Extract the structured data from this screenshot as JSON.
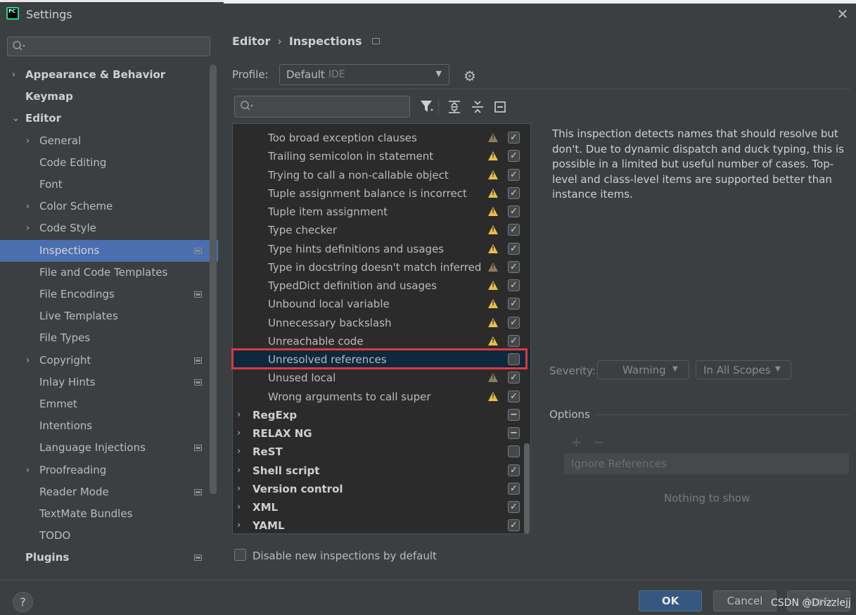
{
  "window": {
    "title": "Settings"
  },
  "sidebar": {
    "search_placeholder": "",
    "items": [
      {
        "label": "Appearance & Behavior",
        "bold": true,
        "chevron": "›",
        "level": 0
      },
      {
        "label": "Keymap",
        "bold": true,
        "chevron": "",
        "level": 0
      },
      {
        "label": "Editor",
        "bold": true,
        "chevron": "⌄",
        "level": 0
      },
      {
        "label": "General",
        "chevron": "›",
        "level": 1
      },
      {
        "label": "Code Editing",
        "chevron": "",
        "level": 1
      },
      {
        "label": "Font",
        "chevron": "",
        "level": 1
      },
      {
        "label": "Color Scheme",
        "chevron": "›",
        "level": 1
      },
      {
        "label": "Code Style",
        "chevron": "›",
        "level": 1
      },
      {
        "label": "Inspections",
        "chevron": "",
        "level": 1,
        "selected": true,
        "project_icon": true
      },
      {
        "label": "File and Code Templates",
        "chevron": "",
        "level": 1
      },
      {
        "label": "File Encodings",
        "chevron": "",
        "level": 1,
        "project_icon": true
      },
      {
        "label": "Live Templates",
        "chevron": "",
        "level": 1
      },
      {
        "label": "File Types",
        "chevron": "",
        "level": 1
      },
      {
        "label": "Copyright",
        "chevron": "›",
        "level": 1,
        "project_icon": true
      },
      {
        "label": "Inlay Hints",
        "chevron": "",
        "level": 1,
        "project_icon": true
      },
      {
        "label": "Emmet",
        "chevron": "",
        "level": 1
      },
      {
        "label": "Intentions",
        "chevron": "",
        "level": 1
      },
      {
        "label": "Language Injections",
        "chevron": "",
        "level": 1,
        "project_icon": true
      },
      {
        "label": "Proofreading",
        "chevron": "›",
        "level": 1
      },
      {
        "label": "Reader Mode",
        "chevron": "",
        "level": 1,
        "project_icon": true
      },
      {
        "label": "TextMate Bundles",
        "chevron": "",
        "level": 1
      },
      {
        "label": "TODO",
        "chevron": "",
        "level": 1
      },
      {
        "label": "Plugins",
        "bold": true,
        "chevron": "",
        "level": 0,
        "project_icon": true
      }
    ]
  },
  "breadcrumb": {
    "parent": "Editor",
    "current": "Inspections"
  },
  "profile": {
    "label": "Profile:",
    "value": "Default",
    "tag": "IDE"
  },
  "inspections": {
    "search_placeholder": "",
    "rows": [
      {
        "label": "Too broad exception clauses",
        "warn": "dim",
        "checked": true
      },
      {
        "label": "Trailing semicolon in statement",
        "warn": "yes",
        "checked": true
      },
      {
        "label": "Trying to call a non-callable object",
        "warn": "yes",
        "checked": true
      },
      {
        "label": "Tuple assignment balance is incorrect",
        "warn": "yes",
        "checked": true
      },
      {
        "label": "Tuple item assignment",
        "warn": "yes",
        "checked": true
      },
      {
        "label": "Type checker",
        "warn": "yes",
        "checked": true
      },
      {
        "label": "Type hints definitions and usages",
        "warn": "yes",
        "checked": true
      },
      {
        "label": "Type in docstring doesn't match inferred t",
        "warn": "dim",
        "checked": true
      },
      {
        "label": "TypedDict definition and usages",
        "warn": "yes",
        "checked": true
      },
      {
        "label": "Unbound local variable",
        "warn": "yes",
        "checked": true
      },
      {
        "label": "Unnecessary backslash",
        "warn": "yes",
        "checked": true
      },
      {
        "label": "Unreachable code",
        "warn": "yes",
        "checked": true
      },
      {
        "label": "Unresolved references",
        "warn": "none",
        "checked": false,
        "highlight": true
      },
      {
        "label": "Unused local",
        "warn": "dim",
        "checked": true
      },
      {
        "label": "Wrong arguments to call super",
        "warn": "yes",
        "checked": true
      }
    ],
    "groups": [
      {
        "label": "RegExp",
        "state": "partial"
      },
      {
        "label": "RELAX NG",
        "state": "partial"
      },
      {
        "label": "ReST",
        "state": "unchecked"
      },
      {
        "label": "Shell script",
        "state": "checked"
      },
      {
        "label": "Version control",
        "state": "checked"
      },
      {
        "label": "XML",
        "state": "checked"
      },
      {
        "label": "YAML",
        "state": "checked"
      }
    ]
  },
  "description": "This inspection detects names that should resolve but don't. Due to dynamic dispatch and duck typing, this is possible in a limited but useful number of cases. Top-level and class-level items are supported better than instance items.",
  "severity": {
    "label": "Severity:",
    "value": "Warning",
    "scope": "In All Scopes"
  },
  "options": {
    "label": "Options",
    "add": "+",
    "remove": "−",
    "list_header": "Ignore References",
    "empty_text": "Nothing to show"
  },
  "disable_new": {
    "label": "Disable new inspections by default",
    "checked": false
  },
  "footer": {
    "help": "?",
    "ok": "OK",
    "cancel": "Cancel",
    "apply": "Apply",
    "watermark": "CSDN @Drizzlejj"
  },
  "colors": {
    "background": "#3c3f41",
    "list_bg": "#2b2b2b",
    "selection": "#4b6eaf",
    "row_highlight": "#0d293e",
    "red_outline": "#e0373f",
    "warning": "#e8c04a",
    "ok_button": "#365880"
  },
  "icons": {
    "app": "pycharm-logo",
    "close": "close-icon",
    "gear": "gear-icon",
    "filter": "filter-icon",
    "expand": "expand-all-icon",
    "collapse": "collapse-all-icon",
    "reset": "reset-icon",
    "warning": "warning-icon"
  }
}
